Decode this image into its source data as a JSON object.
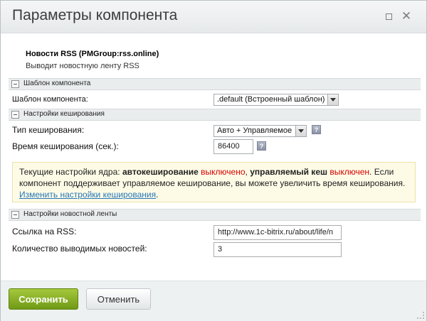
{
  "window": {
    "title": "Параметры компонента",
    "maximize_glyph": "",
    "close_glyph": "✕"
  },
  "component": {
    "name": "Новости RSS (PMGroup:rss.online)",
    "description": "Выводит новостную ленту RSS"
  },
  "sections": {
    "template": {
      "title": "Шаблон компонента",
      "field_label": "Шаблон компонента:",
      "field_value": ".default (Встроенный шаблон)"
    },
    "caching": {
      "title": "Настройки кеширования",
      "type_label": "Тип кеширования:",
      "type_value": "Авто + Управляемое",
      "time_label": "Время кеширования (сек.):",
      "time_value": "86400"
    },
    "feed": {
      "title": "Настройки новостной ленты",
      "rss_label": "Ссылка на RSS:",
      "rss_value": "http://www.1c-bitrix.ru/about/life/n",
      "count_label": "Количество выводимых новостей:",
      "count_value": "3"
    }
  },
  "help_glyph": "?",
  "notice": {
    "p1": "Текущие настройки ядра: ",
    "autocache": "автокеширование",
    "p2": " ",
    "off1": "выключено",
    "p3": ", ",
    "managed": "управляемый кеш",
    "p4": " ",
    "off2": "выключен",
    "p5": ". Если компонент поддерживает управляемое кеширование, вы можете увеличить время кеширования. ",
    "link": "Изменить настройки кеширования",
    "p6": "."
  },
  "footer": {
    "save_label": "Сохранить",
    "cancel_label": "Отменить"
  },
  "colors": {
    "accent_green": "#7aa41c",
    "warning_red": "#d50000",
    "link_blue": "#2777b8"
  }
}
